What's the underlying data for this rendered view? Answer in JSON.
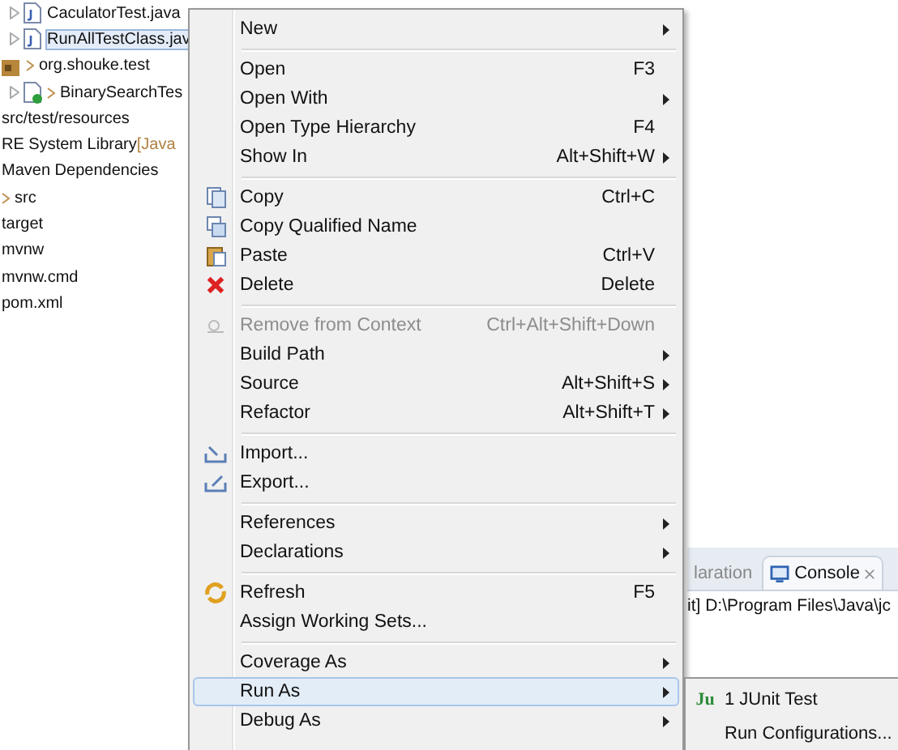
{
  "tree": {
    "items": [
      {
        "label": "CaculatorTest.java",
        "kind": "file",
        "selected": false
      },
      {
        "label": "RunAllTestClass.jav",
        "kind": "file",
        "selected": true
      },
      {
        "label": "org.shouke.test",
        "kind": "package",
        "selected": false,
        "children": [
          {
            "label": "BinarySearchTes",
            "kind": "file",
            "selected": false
          }
        ]
      }
    ],
    "roots": [
      {
        "label": "src/test/resources",
        "kind": "plain"
      },
      {
        "label": "RE System Library",
        "suffix": "[Java",
        "kind": "plain"
      },
      {
        "label": "Maven Dependencies",
        "kind": "plain"
      },
      {
        "label": "src",
        "kind": "folder"
      },
      {
        "label": "target",
        "kind": "plain"
      },
      {
        "label": "mvnw",
        "kind": "plain"
      },
      {
        "label": "mvnw.cmd",
        "kind": "plain"
      },
      {
        "label": "pom.xml",
        "kind": "plain"
      }
    ]
  },
  "context_menu": {
    "sections": [
      [
        {
          "label": "New",
          "submenu": true,
          "disabled": false,
          "selected": false
        }
      ],
      [
        {
          "label": "Open",
          "shortcut": "F3",
          "submenu": false,
          "disabled": false,
          "selected": false
        },
        {
          "label": "Open With",
          "submenu": true,
          "disabled": false,
          "selected": false
        },
        {
          "label": "Open Type Hierarchy",
          "shortcut": "F4",
          "submenu": false,
          "disabled": false,
          "selected": false
        },
        {
          "label": "Show In",
          "shortcut": "Alt+Shift+W",
          "submenu": true,
          "disabled": false,
          "selected": false
        }
      ],
      [
        {
          "label": "Copy",
          "shortcut": "Ctrl+C",
          "submenu": false,
          "disabled": false,
          "selected": false
        },
        {
          "label": "Copy Qualified Name",
          "submenu": false,
          "disabled": false,
          "selected": false
        },
        {
          "label": "Paste",
          "shortcut": "Ctrl+V",
          "submenu": false,
          "disabled": false,
          "selected": false
        },
        {
          "label": "Delete",
          "shortcut": "Delete",
          "submenu": false,
          "disabled": false,
          "selected": false
        }
      ],
      [
        {
          "label": "Remove from Context",
          "shortcut": "Ctrl+Alt+Shift+Down",
          "submenu": false,
          "disabled": true,
          "selected": false
        },
        {
          "label": "Build Path",
          "submenu": true,
          "disabled": false,
          "selected": false
        },
        {
          "label": "Source",
          "shortcut": "Alt+Shift+S",
          "submenu": true,
          "disabled": false,
          "selected": false
        },
        {
          "label": "Refactor",
          "shortcut": "Alt+Shift+T",
          "submenu": true,
          "disabled": false,
          "selected": false
        }
      ],
      [
        {
          "label": "Import...",
          "submenu": false,
          "disabled": false,
          "selected": false
        },
        {
          "label": "Export...",
          "submenu": false,
          "disabled": false,
          "selected": false
        }
      ],
      [
        {
          "label": "References",
          "submenu": true,
          "disabled": false,
          "selected": false
        },
        {
          "label": "Declarations",
          "submenu": true,
          "disabled": false,
          "selected": false
        }
      ],
      [
        {
          "label": "Refresh",
          "shortcut": "F5",
          "submenu": false,
          "disabled": false,
          "selected": false
        },
        {
          "label": "Assign Working Sets...",
          "submenu": false,
          "disabled": false,
          "selected": false
        }
      ],
      [
        {
          "label": "Coverage As",
          "submenu": true,
          "disabled": false,
          "selected": false
        },
        {
          "label": "Run As",
          "submenu": true,
          "disabled": false,
          "selected": true
        },
        {
          "label": "Debug As",
          "submenu": true,
          "disabled": false,
          "selected": false
        }
      ]
    ]
  },
  "console": {
    "tabs": [
      {
        "label": "laration",
        "selected": false,
        "closable": false
      },
      {
        "label": "Console",
        "selected": true,
        "closable": true
      }
    ],
    "line": "it] D:\\Program Files\\Java\\jc"
  },
  "submenu": {
    "items": [
      {
        "label": "1 JUnit Test",
        "icon": "Ju"
      },
      {
        "label": "Run Configurations..."
      }
    ]
  }
}
